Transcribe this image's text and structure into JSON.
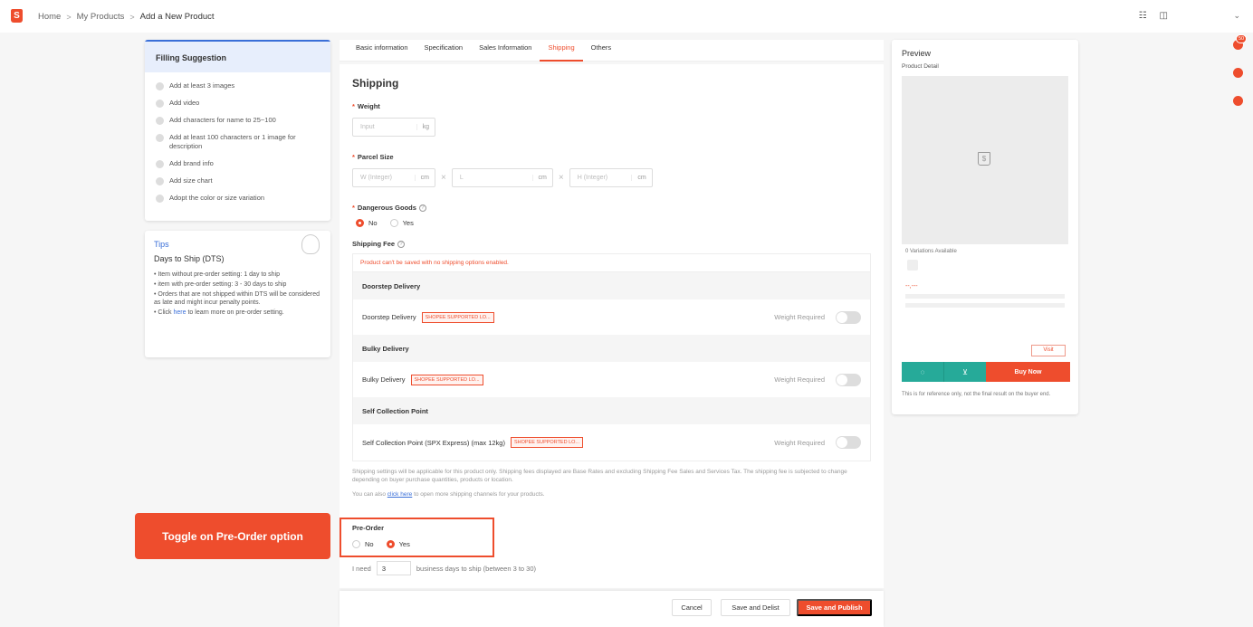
{
  "topbar": {
    "logo": "S",
    "breadcrumbs": [
      "Home",
      "My Products",
      "Add a New Product"
    ],
    "sep": ">",
    "icons": [
      "apps-icon",
      "book-icon",
      "chevron-down-icon"
    ]
  },
  "suggestion": {
    "title": "Filling Suggestion",
    "items": [
      "Add at least 3 images",
      "Add video",
      "Add characters for name to 25~100",
      "Add at least 100 characters or 1 image for description",
      "Add brand info",
      "Add size chart",
      "Adopt the color or size variation"
    ]
  },
  "tips": {
    "title": "Tips",
    "subtitle": "Days to Ship (DTS)",
    "items": [
      "• Item without pre-order setting: 1 day to ship",
      "• item with pre-order setting: 3 - 30 days to ship",
      "• Orders that are not shipped within DTS will be considered as late and might incur penalty points."
    ],
    "last_prefix": "• Click ",
    "last_link": "here",
    "last_suffix": " to learn more on pre-order setting."
  },
  "callout": "Toggle on Pre-Order option",
  "tabs": [
    "Basic information",
    "Specification",
    "Sales Information",
    "Shipping",
    "Others"
  ],
  "active_tab": "Shipping",
  "shipping": {
    "title": "Shipping",
    "weight_label": "Weight",
    "weight_placeholder": "Input",
    "weight_unit": "kg",
    "parcel_label": "Parcel Size",
    "w_placeholder": "W (Integer)",
    "l_placeholder": "L",
    "h_placeholder": "H (Integer)",
    "size_unit": "cm",
    "size_sep": "×",
    "dangerous_label": "Dangerous Goods",
    "no": "No",
    "yes": "Yes",
    "fee_label": "Shipping Fee",
    "fee_warning": "Product can't be saved with no shipping options enabled.",
    "groups": [
      {
        "head": "Doorstep Delivery",
        "row": "Doorstep Delivery",
        "tag": "SHOPEE SUPPORTED LO...",
        "req": "Weight Required"
      },
      {
        "head": "Bulky Delivery",
        "row": "Bulky Delivery",
        "tag": "SHOPEE SUPPORTED LO...",
        "req": "Weight Required"
      },
      {
        "head": "Self Collection Point",
        "row": "Self Collection Point (SPX Express)  (max 12kg)",
        "tag": "SHOPEE SUPPORTED LO...",
        "req": "Weight Required"
      }
    ],
    "note1": "Shipping settings will be applicable for this product only. Shipping fees displayed are Base Rates and excluding Shipping Fee Sales and Services Tax. The shipping fee is subjected to change depending on buyer purchase quantities, products or location.",
    "note2_prefix": "You can also ",
    "note2_link": "click here",
    "note2_suffix": " to open more shipping channels for your products."
  },
  "preorder": {
    "label": "Pre-Order",
    "no": "No",
    "yes": "Yes",
    "days_prefix": "I need",
    "days_value": "3",
    "days_suffix": "business days to ship (between 3 to 30)"
  },
  "footer": {
    "cancel": "Cancel",
    "delist": "Save and Delist",
    "publish": "Save and Publish"
  },
  "preview": {
    "title": "Preview",
    "subtitle": "Product Detail",
    "variations": "0 Variations Available",
    "price": "--,---",
    "visit": "Visit",
    "buy_now": "Buy Now",
    "note": "This is for reference only, not the final result on the buyer end."
  },
  "rail": {
    "badge": "50"
  },
  "colors": {
    "accent": "#ee4d2d",
    "link": "#3a6fd8",
    "teal": "#26aa99"
  }
}
